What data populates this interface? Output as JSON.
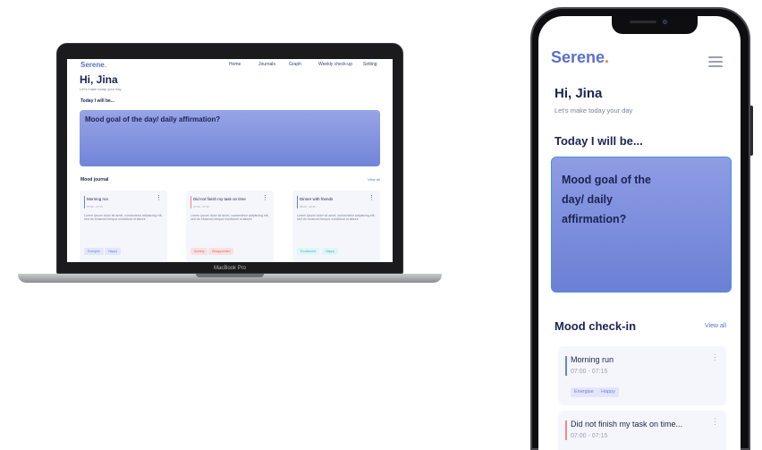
{
  "laptop": {
    "device_label": "MacBook Pro",
    "logo": "Serene",
    "logo_dot": ".",
    "nav": [
      "Home",
      "Journals",
      "Graph",
      "Weekly check-up",
      "Setting"
    ],
    "greeting": "Hi, Jina",
    "subtitle": "Let's make today your day",
    "today_heading": "Today I will be...",
    "mood_prompt": "Mood goal of the day/ daily affirmation?",
    "section_title": "Mood journal",
    "view_all": "View all",
    "cards": [
      {
        "title": "Morning run",
        "time": "07:00 - 07:15",
        "body": "Lorem ipsum dolor sit amet, consectetur adipiscing elit, sed do eiusmod tempor incididunt ut labore",
        "tags": [
          "Energise",
          "Happy"
        ]
      },
      {
        "title": "Did not finish my task on time",
        "time": "07:00 - 07:15",
        "body": "Lorem ipsum dolor sit amet, consectetur adipiscing elit, sed do eiusmod tempor incididunt ut labore",
        "tags": [
          "Anxiety",
          "Disappointed"
        ]
      },
      {
        "title": "Dinner with friends",
        "time": "08:00 - 12:15",
        "body": "Lorem ipsum dolor sit amet, consectetur adipiscing elit, sed do eiusmod tempor incididunt ut labore",
        "tags": [
          "Excitement",
          "Happy"
        ]
      }
    ]
  },
  "phone": {
    "logo": "Serene",
    "logo_dot": ".",
    "greeting": "Hi, Jina",
    "subtitle": "Let's make today your day",
    "today_heading": "Today I will be...",
    "mood_prompt": "Mood goal of the day/ daily affirmation?",
    "section_title": "Mood check-in",
    "view_all": "View all",
    "cards": [
      {
        "title": "Morning run",
        "time": "07:00 - 07:15",
        "tags": [
          "Energise",
          "Happy"
        ]
      },
      {
        "title": "Did not finish my task on time...",
        "time": "07:00 - 07:15"
      }
    ]
  },
  "colors": {
    "brand": "#5a6fd0",
    "logo_dot": "#f07a55",
    "mood_card": "#7a8edb",
    "tag_positive": "#e3e6fb",
    "tag_negative": "#fbe0e0",
    "tag_excitement": "#dff6f7"
  },
  "icons": [
    "more-vertical-icon",
    "hamburger-menu-icon"
  ]
}
